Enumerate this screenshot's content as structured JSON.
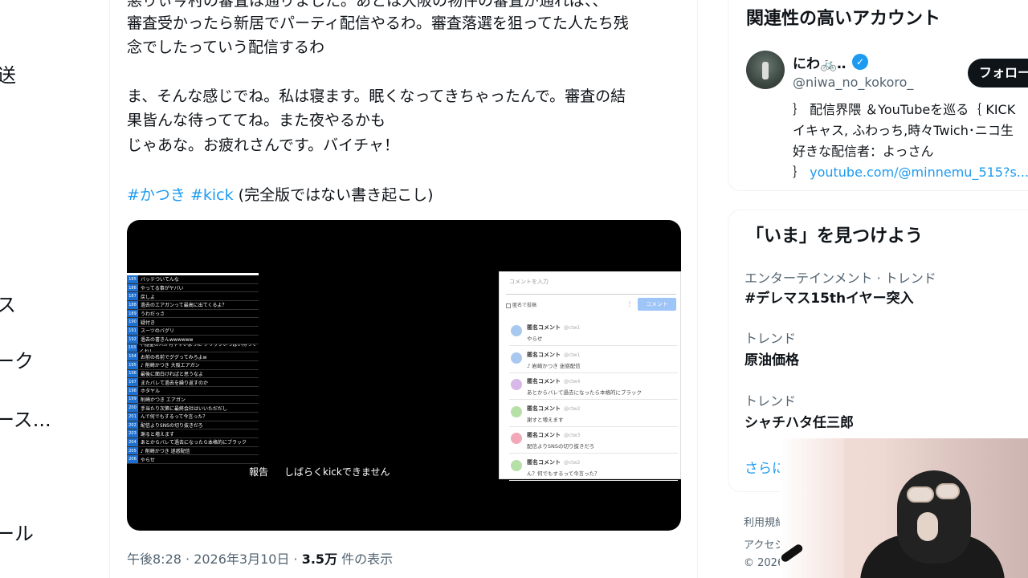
{
  "left_nav": {
    "frag_1": "送",
    "frag_2": "ス",
    "frag_3": "ーク",
    "frag_4": "ース...",
    "frag_5": "ール"
  },
  "tweet": {
    "line_0": "悪りぃ今村の審査は通りました。あとは大阪の物件の審査が通れば、、",
    "line_1": "審査受かったら新居でパーティ配信やるわ。審査落選を狙ってた人たち残",
    "line_2": "念でしたっていう配信するわ",
    "line_3": "ま、そんな感じでね。私は寝ます。眠くなってきちゃったんで。審査の結",
    "line_4": "果皆んな待っててね。また夜やるかも",
    "line_5": "じゃあな。お疲れさんです。バイチャ！",
    "hashtag_1": "#かつき",
    "hashtag_2": "#kick",
    "tag_note": "(完全版ではない書き起こし)",
    "time": "午後8:28 · 2026年3月10日 · ",
    "views_count": "3.5万",
    "views_label": " 件の表示"
  },
  "media": {
    "caption_1": "報告",
    "caption_2": "しばらくkickできません",
    "comment_rows": [
      {
        "num": "185",
        "text": "バッテついてんな"
      },
      {
        "num": "186",
        "text": "やってる事がヤバい"
      },
      {
        "num": "187",
        "text": "戻しよ"
      },
      {
        "num": "188",
        "text": "過去のエアガンって最高に出てくるよ？"
      },
      {
        "num": "189",
        "text": "うわだっさ"
      },
      {
        "num": "190",
        "text": "疑付き"
      },
      {
        "num": "191",
        "text": "スーツのバグリ"
      },
      {
        "num": "192",
        "text": "過去の書きんwwwwww"
      },
      {
        "num": "193",
        "text": "不器量の人が有やすいように クリップいっぱい持ってくね！"
      },
      {
        "num": "194",
        "text": "お前の名前でググってみろよw"
      },
      {
        "num": "195",
        "text": "♪ 削崎かつき 大阪エアガン"
      },
      {
        "num": "196",
        "text": "最後に面白ければと思うなよ"
      },
      {
        "num": "197",
        "text": "またバレて過去を繰り返すのか"
      },
      {
        "num": "198",
        "text": "ホタヤル"
      },
      {
        "num": "199",
        "text": "削崎かつき エアガン"
      },
      {
        "num": "200",
        "text": "手当たり次第に最終会社はいいただだし"
      },
      {
        "num": "201",
        "text": "んで何でもするって今言った？"
      },
      {
        "num": "202",
        "text": "配信よりSNSの切り抜きだろ"
      },
      {
        "num": "203",
        "text": "謝ると増えます"
      },
      {
        "num": "204",
        "text": "あとからバレて過去になったら本格的にブラック"
      },
      {
        "num": "205",
        "text": "♪ 削崎かつき 迷惑配信"
      },
      {
        "num": "206",
        "text": "やらせ"
      }
    ],
    "panel": {
      "input_placeholder": "コメントを入力",
      "checkbox_label": "匿名で投稿",
      "submit_label": "コメント",
      "comments": [
        {
          "name": "匿名コメント",
          "id": "@ctw1",
          "text": "やらせ",
          "color": "#a8c8f0"
        },
        {
          "name": "匿名コメント",
          "id": "@ctw1",
          "text": "♪ 岩崎かつき 迷惑配信",
          "color": "#a8c8f0"
        },
        {
          "name": "匿名コメント",
          "id": "@ctw4",
          "text": "あとからバレて過去になったら本格的にブラック",
          "color": "#d7b8e8"
        },
        {
          "name": "匿名コメント",
          "id": "@ctw2",
          "text": "謝すと増えます",
          "color": "#b6e0a8"
        },
        {
          "name": "匿名コメント",
          "id": "@ctw3",
          "text": "配信よりSNSの切り抜きだろ",
          "color": "#f2a8b8"
        },
        {
          "name": "匿名コメント",
          "id": "@ctw2",
          "text": "ん？何でもするって今言った？",
          "color": "#b6e0a8"
        }
      ]
    }
  },
  "sidebar": {
    "related_title": "関連性の高いアカウント",
    "account": {
      "name": "にわ🚲‥",
      "verified_glyph": "✓",
      "handle": "@niwa_no_kokoro_",
      "follow_label": "フォロー",
      "bio_1": "｝ 配信界隈 ＆YouTubeを巡る｛  KICK",
      "bio_2": "イキャス, ふわっち,時々Twich･ニコ生",
      "bio_3": "好きな配信者：よっさん",
      "bio_4_prefix": "｝ ",
      "bio_4_link": "youtube.com/@minnemu_515?s..."
    },
    "trends_title": "「いま」を見つけよう",
    "trends": [
      {
        "category": "エンターテインメント · トレンド",
        "name": "#デレマス15thイヤー突入"
      },
      {
        "category": "トレンド",
        "name": "原油価格"
      },
      {
        "category": "トレンド",
        "name": "シャチハタ任三郎"
      }
    ],
    "show_more": "さらに表示",
    "footer_1": "利用規約",
    "footer_2": "アクセシビリティ",
    "footer_3": "© 2026"
  },
  "colors": {
    "accent": "#1d9bf0",
    "text": "#0f1419",
    "muted": "#536471"
  }
}
